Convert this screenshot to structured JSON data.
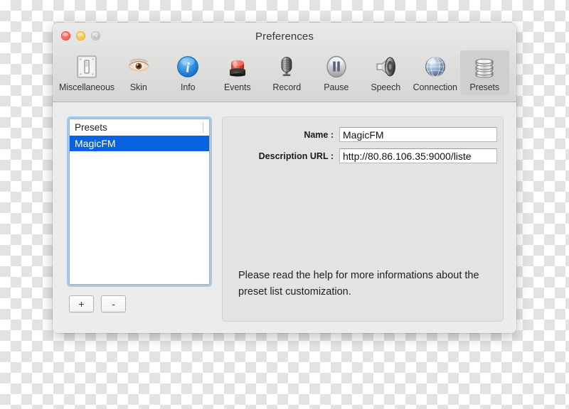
{
  "window": {
    "title": "Preferences",
    "traffic_lights": [
      {
        "name": "close",
        "color": "#f4524d"
      },
      {
        "name": "minimize",
        "color": "#f6bc2e"
      },
      {
        "name": "zoom",
        "color": "#c7c7c7"
      }
    ]
  },
  "toolbar": {
    "items": [
      {
        "label": "Miscellaneous",
        "icon": "light-switch-icon",
        "selected": false
      },
      {
        "label": "Skin",
        "icon": "eye-icon",
        "selected": false
      },
      {
        "label": "Info",
        "icon": "info-circle-icon",
        "selected": false
      },
      {
        "label": "Events",
        "icon": "siren-light-icon",
        "selected": false
      },
      {
        "label": "Record",
        "icon": "microphone-icon",
        "selected": false
      },
      {
        "label": "Pause",
        "icon": "pause-circle-icon",
        "selected": false
      },
      {
        "label": "Speech",
        "icon": "loudspeaker-icon",
        "selected": false
      },
      {
        "label": "Connection",
        "icon": "globe-icon",
        "selected": false
      },
      {
        "label": "Presets",
        "icon": "database-stack-icon",
        "selected": true
      }
    ]
  },
  "presets_list": {
    "header": "Presets",
    "rows": [
      {
        "label": "MagicFM",
        "selected": true
      }
    ],
    "add_button": "+",
    "remove_button": "-"
  },
  "detail": {
    "name_label": "Name :",
    "name_value": "MagicFM",
    "url_label": "Description URL  :",
    "url_value": "http://80.86.106.35:9000/liste",
    "help_text": "Please read the help for more informations about the preset list customization."
  },
  "colors": {
    "selection_blue": "#0a62e0",
    "focus_ring": "#a3c9ef",
    "window_bg": "#ececec",
    "panel_bg": "#e3e3e3",
    "toolbar_selected": "#cfcfcf"
  }
}
